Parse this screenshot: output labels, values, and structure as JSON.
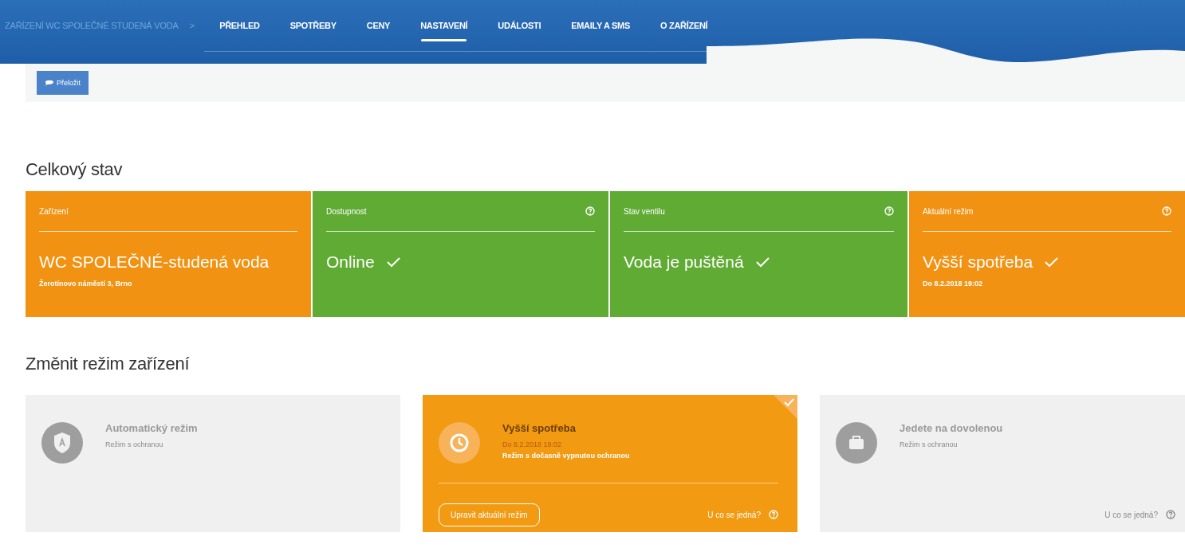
{
  "header": {
    "breadcrumb": "ZAŘÍZENÍ WC SPOLEČNÉ STUDENÁ VODA",
    "separator": ">",
    "tabs": [
      {
        "label": "PŘEHLED",
        "selected": false
      },
      {
        "label": "SPOTŘEBY",
        "selected": false
      },
      {
        "label": "CENY",
        "selected": false
      },
      {
        "label": "NASTAVENÍ",
        "selected": true
      },
      {
        "label": "UDÁLOSTI",
        "selected": false
      },
      {
        "label": "EMAILY A SMS",
        "selected": false
      },
      {
        "label": "O ZAŘÍZENÍ",
        "selected": false
      }
    ]
  },
  "translate_button": "Přeložit",
  "overall": {
    "heading": "Celkový stav",
    "cards": [
      {
        "label": "Zařízení",
        "color": "#f29212",
        "help": false,
        "value": "WC SPOLEČNÉ-studená voda",
        "ok": false,
        "note": "Žerotínovo náměstí 3, Brno"
      },
      {
        "label": "Dostupnost",
        "color": "#5fab34",
        "help": true,
        "value": "Online",
        "ok": true
      },
      {
        "label": "Stav ventilu",
        "color": "#5fab34",
        "help": true,
        "value": "Voda je puštěná",
        "ok": true
      },
      {
        "label": "Aktuální režim",
        "color": "#f29212",
        "help": true,
        "value": "Vyšší spotřeba",
        "ok": true,
        "note": "Do 8.2.2018 19:02"
      }
    ]
  },
  "modes": {
    "heading": "Změnit režim zařízení",
    "cards": [
      {
        "kind": "shield",
        "title": "Automatický režim",
        "subtitle": "Režim s ochranou",
        "selected": false
      },
      {
        "kind": "clock",
        "title": "Vyšší spotřeba",
        "date": "Do 8.2.2018 19:02",
        "subtitle": "Režim s dočasně vypnutou ochranou",
        "selected": true,
        "button": "Upravit aktuální režim",
        "link": "U co se jedná?"
      },
      {
        "kind": "suitcase",
        "title": "Jedete na dovolenou",
        "subtitle": "Režim s ochranou",
        "selected": false,
        "link": "U co se jedná?"
      }
    ]
  }
}
